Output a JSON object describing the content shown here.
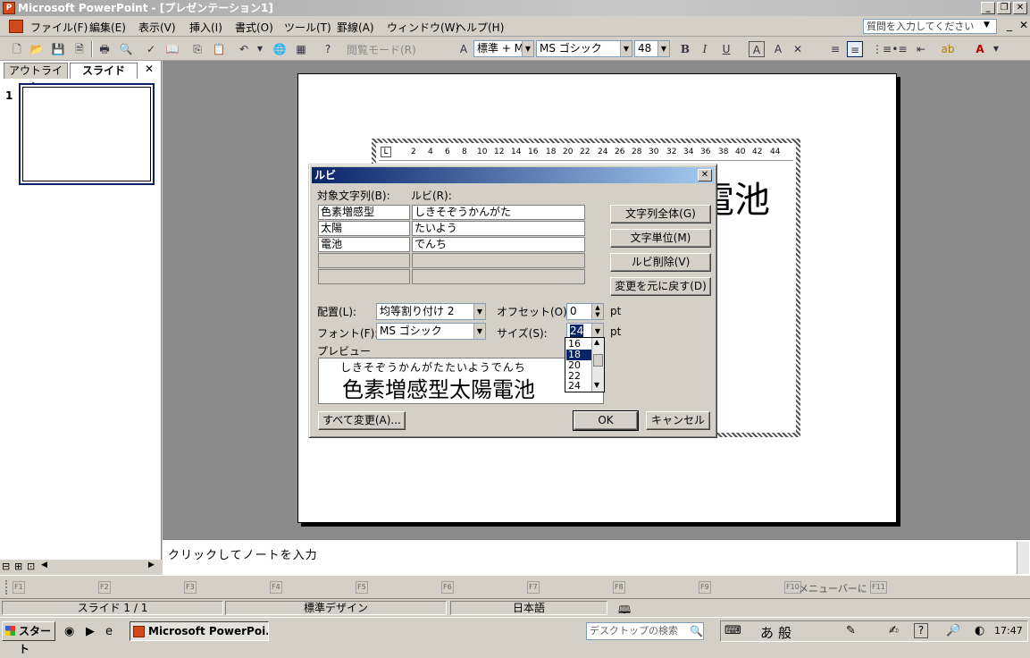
{
  "window": {
    "title": "Microsoft PowerPoint - [プレゼンテーション1]",
    "app_icon": "P"
  },
  "menu": [
    "ファイル(F)",
    "編集(E)",
    "表示(V)",
    "挿入(I)",
    "書式(O)",
    "ツール(T)",
    "罫線(A)",
    "ウィンドウ(W)",
    "ヘルプ(H)"
  ],
  "help_placeholder": "質問を入力してください",
  "toolbar": {
    "reading_mode": "閲覧モード(R)",
    "style": "標準 + M",
    "font": "MS ゴシック",
    "size": "48"
  },
  "tabs": {
    "outline": "アウトライン",
    "slide": "スライド",
    "close": "✕"
  },
  "slide_number": "1",
  "ruler_ticks": [
    "2",
    "4",
    "6",
    "8",
    "10",
    "12",
    "14",
    "16",
    "18",
    "20",
    "22",
    "24",
    "26",
    "28",
    "30",
    "32",
    "34",
    "36",
    "38",
    "40",
    "42",
    "44"
  ],
  "slide_text": "電池",
  "dialog": {
    "title": "ルビ",
    "col_target": "対象文字列(B):",
    "col_ruby": "ルビ(R):",
    "rows": [
      {
        "target": "色素増感型",
        "ruby": "しきそぞうかんがた"
      },
      {
        "target": "太陽",
        "ruby": "たいよう"
      },
      {
        "target": "電池",
        "ruby": "でんち"
      }
    ],
    "btn_whole": "文字列全体(G)",
    "btn_unit": "文字単位(M)",
    "btn_delete": "ルビ削除(V)",
    "btn_revert": "変更を元に戻す(D)",
    "align_label": "配置(L):",
    "align_value": "均等割り付け 2",
    "offset_label": "オフセット(O):",
    "offset_value": "0",
    "pt1": "pt",
    "font_label": "フォント(F):",
    "font_value": "MS ゴシック",
    "size_label": "サイズ(S):",
    "size_value": "24",
    "pt2": "pt",
    "preview_label": "プレビュー",
    "preview_ruby": "しきそぞうかんがたたいようでんち",
    "preview_text": "色素増感型太陽電池",
    "size_options": [
      "16",
      "18",
      "20",
      "22",
      "24"
    ],
    "size_selected": "18",
    "btn_change_all": "すべて変更(A)...",
    "btn_ok": "OK",
    "btn_cancel": "キャンセル"
  },
  "notes_placeholder": "クリックしてノートを入力",
  "fkeys": [
    "F1",
    "F2",
    "F3",
    "F4",
    "F5",
    "F6",
    "F7",
    "F8",
    "F9",
    "F10",
    "F11"
  ],
  "fkey_note": "メニューバーに",
  "status": {
    "slide": "スライド 1 / 1",
    "design": "標準デザイン",
    "language": "日本語"
  },
  "taskbar": {
    "start": "スタート",
    "task": "Microsoft PowerPoi...",
    "search": "デスクトップの検索",
    "clock": "17:47",
    "ime_a": "あ",
    "ime_mode": "般"
  }
}
